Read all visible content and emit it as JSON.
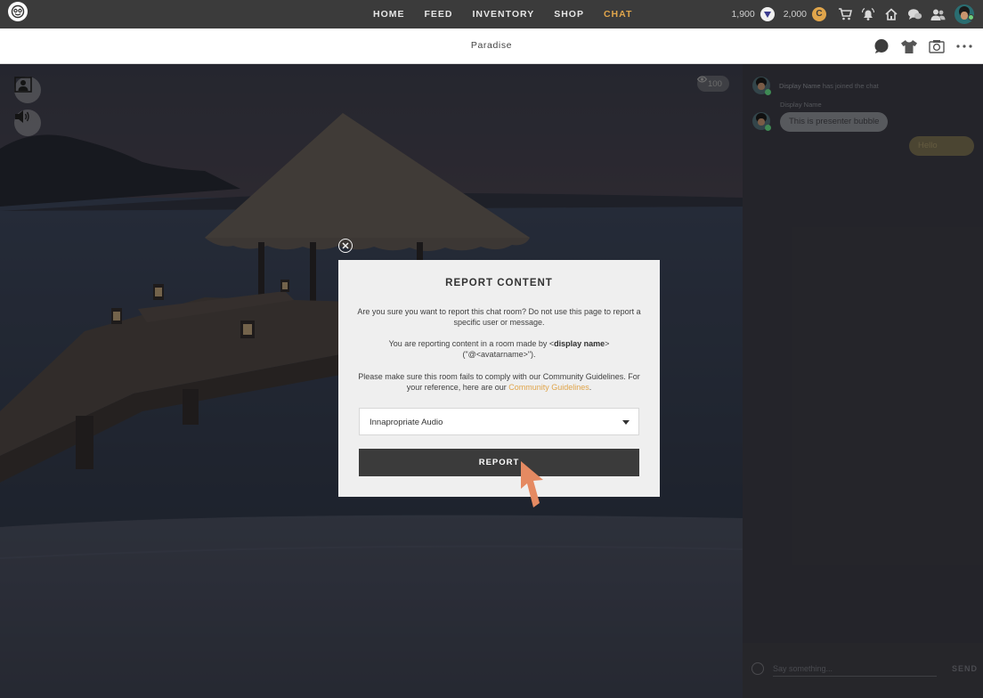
{
  "nav": {
    "links": [
      {
        "label": "HOME",
        "active": false
      },
      {
        "label": "FEED",
        "active": false
      },
      {
        "label": "INVENTORY",
        "active": false
      },
      {
        "label": "SHOP",
        "active": false
      },
      {
        "label": "CHAT",
        "active": true
      }
    ],
    "vcoin_amount": "1,900",
    "credits_amount": "2,000",
    "credits_symbol": "C",
    "icons": [
      "cart-icon",
      "bell-icon",
      "home-icon",
      "chat-bubbles-icon",
      "people-icon"
    ]
  },
  "room": {
    "title": "Paradise",
    "viewer_count": "100"
  },
  "chat": {
    "messages": [
      {
        "type": "system",
        "name": "Display Name",
        "text": "has joined the chat"
      },
      {
        "type": "bubble",
        "name": "Display Name",
        "text": "This is  presenter bubble"
      },
      {
        "type": "own",
        "text": "Hello"
      }
    ],
    "input_placeholder": "Say something...",
    "send_label": "SEND"
  },
  "modal": {
    "title": "REPORT CONTENT",
    "para1": "Are you sure you want to report this chat room? Do not use this page to report a specific user or message.",
    "para2_prefix": "You are reporting content in a room made by <",
    "para2_name": "display name",
    "para2_suffix": ">",
    "para2_line2": "(\"@<avatarname>\").",
    "para3": "Please make sure this room fails to comply with our Community Guidelines. For your reference, here are our ",
    "para3_link": "Community Guidelines",
    "para3_end": ".",
    "select_value": "Innapropriate Audio",
    "report_label": "REPORT"
  },
  "colors": {
    "accent": "#e0a54b",
    "nav_bg": "#3b3b3b",
    "report_button": "#3b3b3b",
    "cursor": "#e58a62"
  }
}
